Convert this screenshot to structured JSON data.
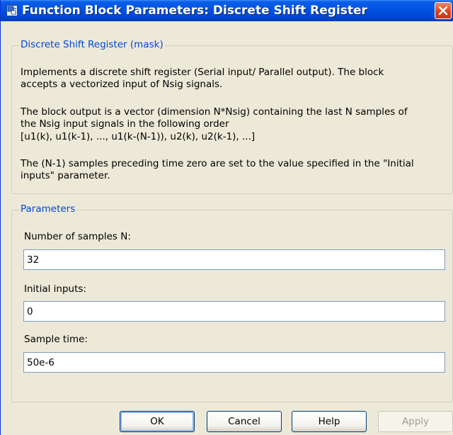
{
  "window": {
    "title": "Function Block Parameters: Discrete Shift Register"
  },
  "description_group": {
    "legend": "Discrete Shift Register (mask)",
    "lines": [
      "Implements a discrete shift register (Serial input/ Parallel output). The block",
      "accepts a vectorized input of Nsig signals.",
      "The block output is a vector (dimension N*Nsig) containing the last N samples of",
      "the Nsig input signals in the following order",
      "[u1(k), u1(k-1), ..., u1(k-(N-1)),  u2(k), u2(k-1), ...]",
      "The (N-1) samples preceding time zero are set to the  value specified in the \"Initial",
      "inputs\" parameter."
    ]
  },
  "parameters_group": {
    "legend": "Parameters",
    "fields": [
      {
        "label": "Number of samples N:",
        "value": "32"
      },
      {
        "label": "Initial inputs:",
        "value": "0"
      },
      {
        "label": "Sample time:",
        "value": "50e-6"
      }
    ]
  },
  "buttons": {
    "ok": "OK",
    "cancel": "Cancel",
    "help": "Help",
    "apply": "Apply"
  },
  "colors": {
    "titlebar": "#0054e3",
    "dialog_bg": "#ece9d8",
    "legend_text": "#0046d5",
    "close_button": "#d5411c"
  },
  "icons": {
    "app": "simulink-block-icon",
    "close": "close-icon"
  }
}
